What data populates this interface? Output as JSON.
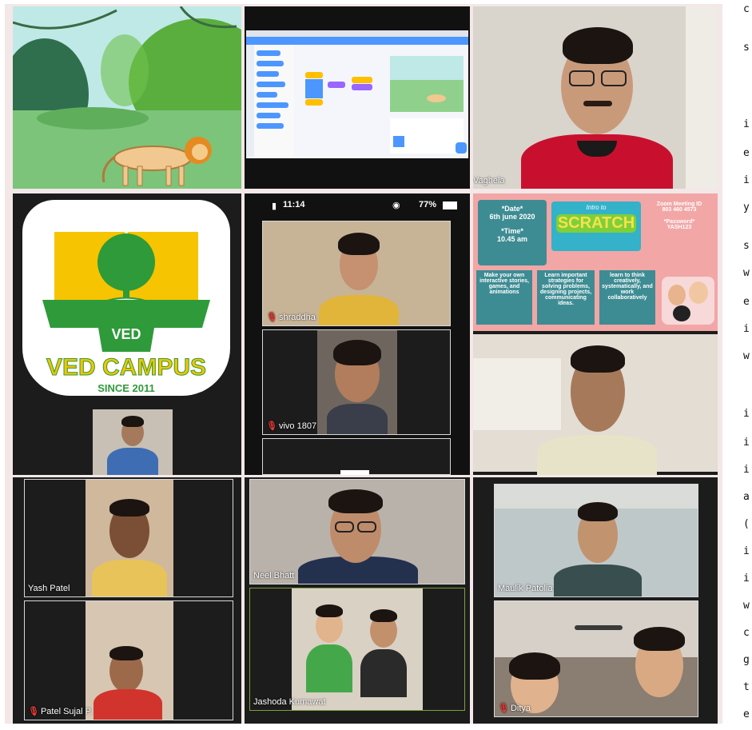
{
  "participants": {
    "vaghela": "Vaghela",
    "shraddha": "shraddha",
    "vivo": "vivo 1807",
    "yash": "Yash Patel",
    "sujal": "Patel Sujal P.",
    "neel": "Neel Bhatt",
    "jashoda": "Jashoda Kumawat",
    "maulik": "Maulik Patolia",
    "ditya": "Ditya"
  },
  "phone_status": {
    "time": "11:14",
    "battery": "77%"
  },
  "logo": {
    "initials": "VED",
    "name": "VED CAMPUS",
    "since": "SINCE 2011"
  },
  "poster": {
    "date_label": "*Date*",
    "date_value": "6th june 2020",
    "time_label": "*Time*",
    "time_value": "10.45 am",
    "title": "SCRATCH",
    "title_prefix": "Intro to",
    "meeting_id_label": "Zoom Meeting ID",
    "meeting_id": "803 460 4573",
    "password_label": "*Password*",
    "password": "YASH123",
    "box1": "Make your own interactive stories, games, and animations",
    "box2": "Learn important strategies for solving problems, designing projects, communicating ideas.",
    "box3": "learn to think creatively, systematically, and work collaboratively"
  },
  "margin_text": [
    "c",
    "s",
    "i",
    "e",
    "i",
    "y",
    "s",
    "w",
    "e",
    "i",
    "w",
    "i",
    "i",
    "i",
    "a",
    "(",
    "i",
    "i",
    "w",
    "c",
    "g",
    "t",
    "e"
  ],
  "colors": {
    "frame": "#f3e7e7",
    "logo_yellow": "#f6c400",
    "logo_green": "#2e9a3a",
    "poster_pink": "#f2a6a6",
    "poster_teal": "#3d8c93"
  }
}
